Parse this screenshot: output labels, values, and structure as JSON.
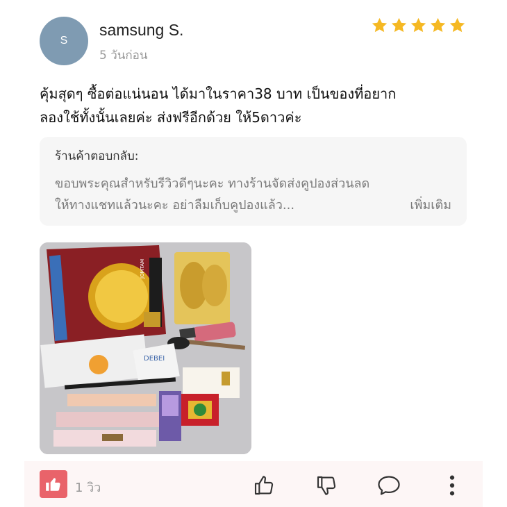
{
  "review": {
    "avatar_initial": "S",
    "username": "samsung S.",
    "time_ago": "5 วันก่อน",
    "rating": 5,
    "star_color": "#f5b823",
    "text_line1": "คุ้มสุดๆ ซื้อต่อแน่นอน ได้มาในราคา38 บาท เป็นของที่อยาก",
    "text_line2": "ลองใช้ทั้งนั้นเลยค่ะ ส่งฟรีอีกด้วย ให้5ดาวค่ะ"
  },
  "shop_reply": {
    "title": "ร้านค้าตอบกลับ:",
    "text_line1": "ขอบพระคุณสำหรับรีวิวดีๆนะคะ ทางร้านจัดส่งคูปองส่วนลด",
    "text_line2": "ให้ทางแชทแล้วนะคะ อย่าลืมเก็บคูปองแล้ว...",
    "more_label": "เพิ่มเติม"
  },
  "photo": {
    "packaging_text": "DEBEI",
    "brand_text": "JOMTAM"
  },
  "footer": {
    "helpful_icon": "thumbs-up-badge-icon",
    "helpful_color": "#e9636a",
    "view_count": "1 วิว",
    "actions": [
      "thumbs-up-icon",
      "thumbs-down-icon",
      "comment-icon",
      "more-vertical-icon"
    ]
  }
}
